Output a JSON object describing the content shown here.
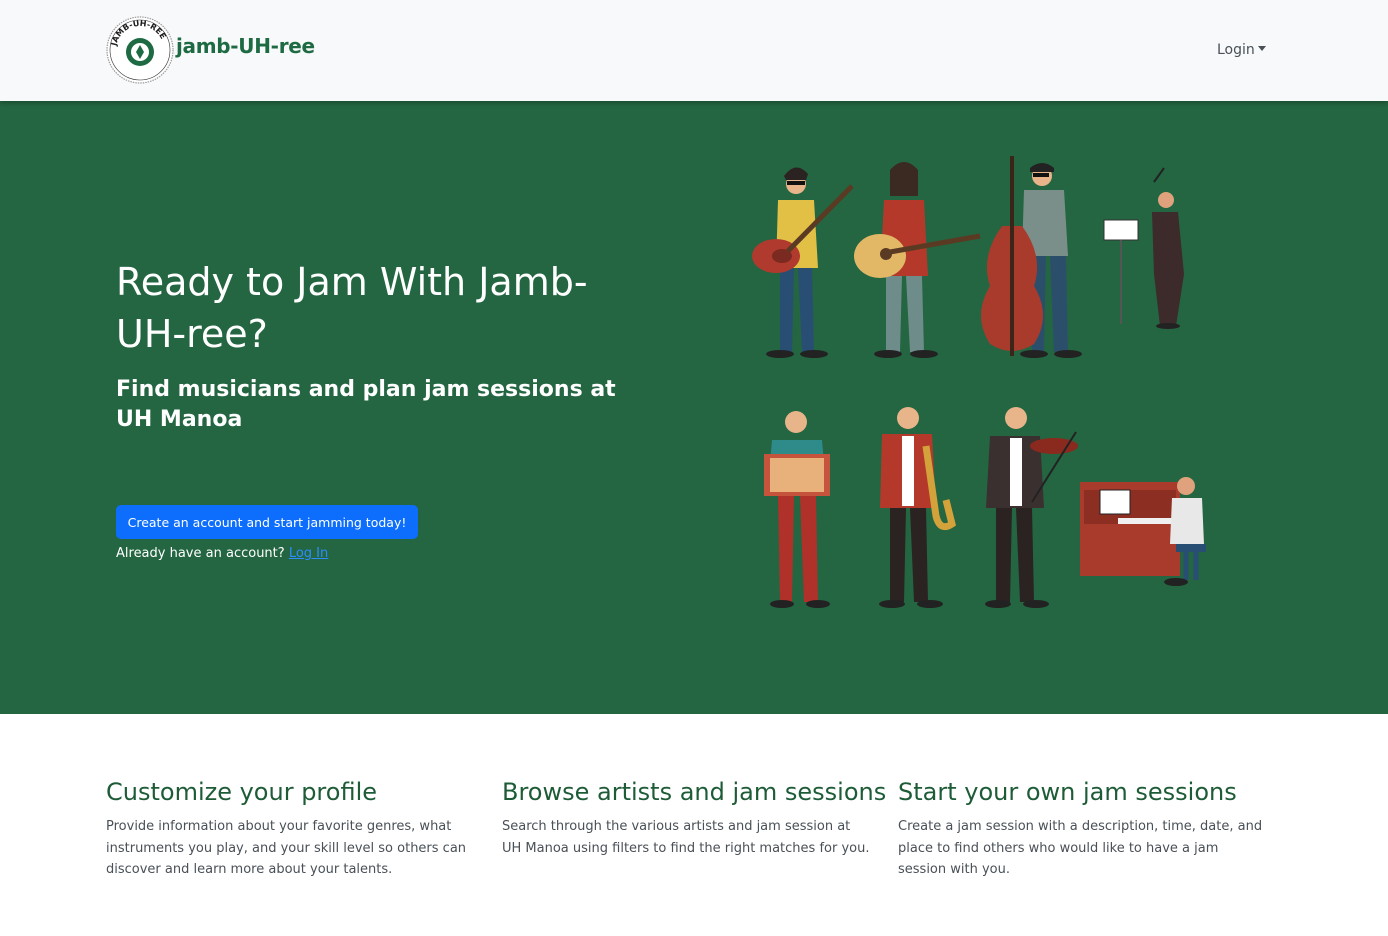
{
  "navbar": {
    "brand": "jamb-UH-ree",
    "logo_text": "JAMB-UH-REE",
    "login_label": "Login"
  },
  "hero": {
    "title": "Ready to Jam With Jamb-UH-ree?",
    "subtitle": "Find musicians and plan jam sessions at UH Manoa",
    "cta_label": "Create an account and start jamming today!",
    "already_text": "Already have an account?",
    "login_link": "Log In"
  },
  "features": [
    {
      "title": "Customize your profile",
      "text": "Provide information about your favorite genres, what instruments you play, and your skill level so others can discover and learn more about your talents."
    },
    {
      "title": "Browse artists and jam sessions",
      "text": "Search through the various artists and jam session at UH Manoa using filters to find the right matches for you."
    },
    {
      "title": "Start your own jam sessions",
      "text": "Create a jam session with a description, time, date, and place to find others who would like to have a jam session with you."
    }
  ],
  "colors": {
    "navbar_bg": "#f8f9fa",
    "brand": "#1e6b43",
    "hero_bg": "#236641",
    "button": "#0d6efd",
    "link": "#2d8cff",
    "feature_heading": "#1e5c37"
  },
  "icons": [
    "logo-seal",
    "caret-down-icon",
    "musicians-illustration"
  ]
}
